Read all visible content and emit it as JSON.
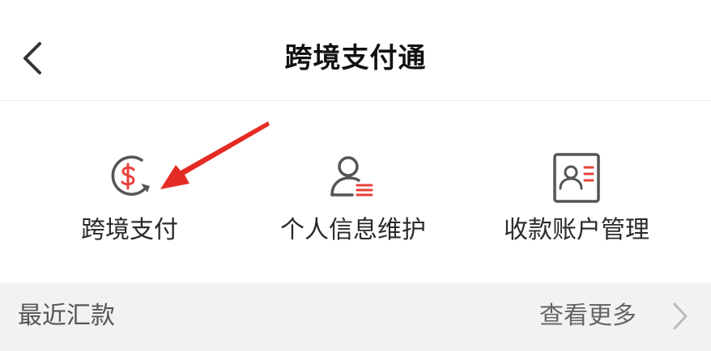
{
  "header": {
    "title": "跨境支付通",
    "back_icon": "chevron-left-icon"
  },
  "features": [
    {
      "label": "跨境支付",
      "icon": "dollar-exchange-icon"
    },
    {
      "label": "个人信息维护",
      "icon": "user-info-icon"
    },
    {
      "label": "收款账户管理",
      "icon": "contact-card-icon"
    }
  ],
  "recent": {
    "title": "最近汇款",
    "more_label": "查看更多",
    "more_icon": "chevron-right-icon"
  },
  "annotation": {
    "icon": "red-pointer-arrow-icon"
  },
  "colors": {
    "accent_red": "#e8413a",
    "arrow_red": "#e42c24",
    "icon_gray": "#555555",
    "section_bg": "#f2f2f2"
  }
}
